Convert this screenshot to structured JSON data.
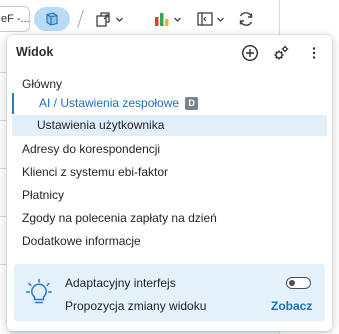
{
  "toolbar": {
    "tab_stub_text": "eF -...",
    "right_icon": "refresh-icon"
  },
  "dropdown": {
    "title": "Widok",
    "add_icon": "plus-circle-icon",
    "settings_icon": "gears-icon",
    "more_icon": "kebab-icon",
    "group_title": "Główny",
    "sub_items": [
      {
        "label": "AI / Ustawienia zespołowe",
        "badge": "D",
        "state": "active"
      },
      {
        "label": "Ustawienia użytkownika",
        "state": "hover"
      }
    ],
    "items": [
      "Adresy do korespondencji",
      "Klienci z systemu ebi-faktor",
      "Płatnicy",
      "Zgody na polecenia zapłaty na dzień",
      "Dodatkowe informacje"
    ]
  },
  "adaptive": {
    "icon": "lightbulb-icon",
    "label": "Adaptacyjny interfejs",
    "toggle_on": false,
    "subtitle": "Propozycja zmiany widoku",
    "link": "Zobacz"
  },
  "colors": {
    "accent": "#1c6fb8",
    "selected_bg": "#b8daf5",
    "hover_bg": "#e2eef8",
    "panel_bg": "#e4f0fa"
  }
}
